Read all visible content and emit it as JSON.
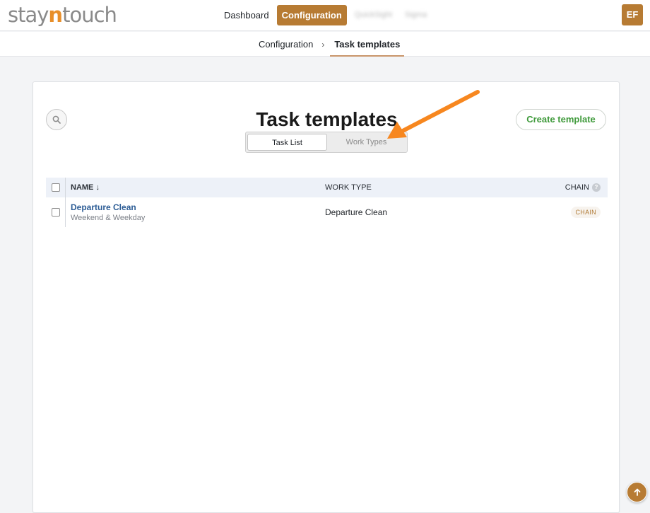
{
  "header": {
    "logo": {
      "part1": "stay",
      "part2": "n",
      "part3": "touch"
    },
    "nav": [
      {
        "label": "Dashboard",
        "active": false,
        "blurred": false
      },
      {
        "label": "Configuration",
        "active": true,
        "blurred": false
      },
      {
        "label": "QuickSight",
        "active": false,
        "blurred": true
      },
      {
        "label": "Sigma",
        "active": false,
        "blurred": true
      }
    ],
    "avatar_initials": "EF"
  },
  "breadcrumb": {
    "parent": "Configuration",
    "separator": "›",
    "current": "Task templates"
  },
  "page": {
    "title": "Task templates",
    "create_label": "Create template",
    "toggle": {
      "active": "Task List",
      "inactive": "Work Types"
    }
  },
  "table": {
    "columns": {
      "name": "NAME ↓",
      "work_type": "WORK TYPE",
      "chain": "CHAIN",
      "chain_help": "?"
    },
    "rows": [
      {
        "name": "Departure Clean",
        "schedule": "Weekend & Weekday",
        "work_type": "Departure Clean",
        "badge": "CHAIN"
      }
    ]
  },
  "colors": {
    "brand": "#b77b33",
    "logo_accent": "#e88f2a",
    "create_text": "#3f9a3b",
    "annotation_arrow": "#f7871f",
    "link": "#2c5c95"
  },
  "icons": {
    "search": "search-icon",
    "scroll_top": "arrow-up-icon",
    "annotation": "annotation-arrow-icon"
  }
}
